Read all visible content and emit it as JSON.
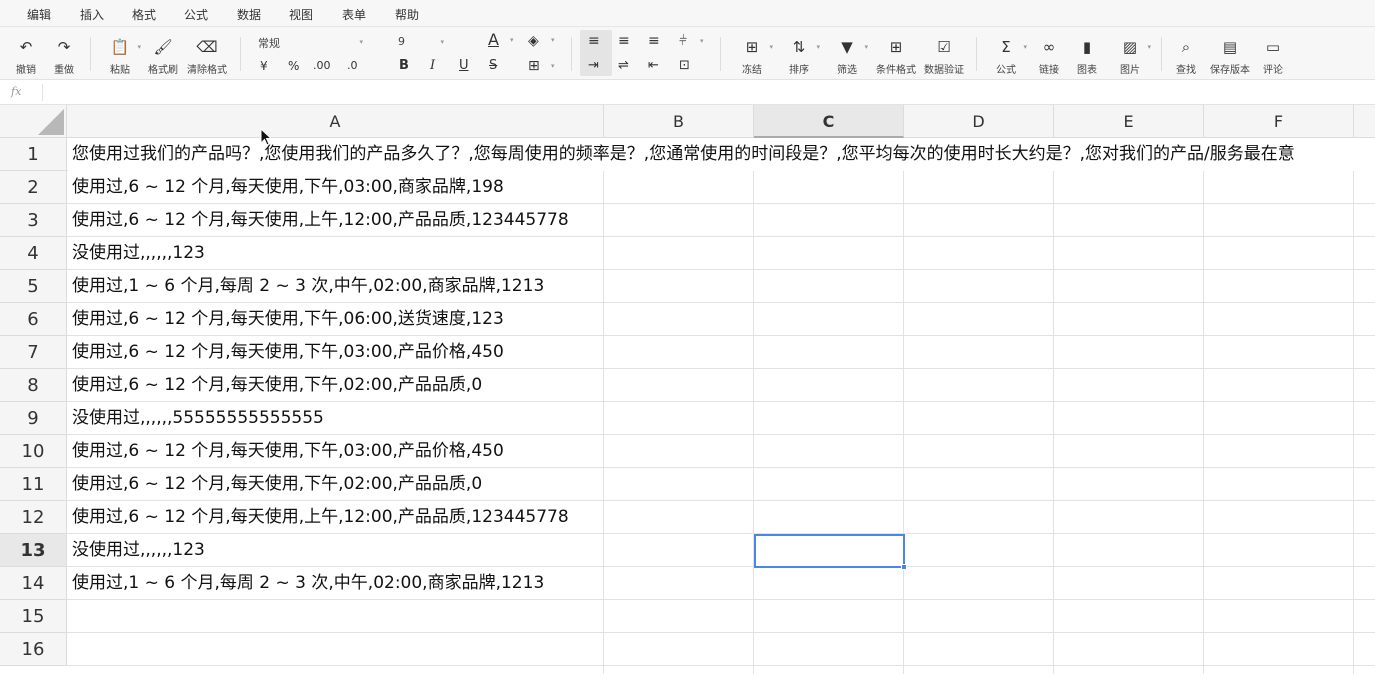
{
  "menu": [
    "编辑",
    "插入",
    "格式",
    "公式",
    "数据",
    "视图",
    "表单",
    "帮助"
  ],
  "toolbar": {
    "undo": "撤销",
    "redo": "重做",
    "paste": "粘贴",
    "format_painter": "格式刷",
    "clear_format": "清除格式",
    "number_format": "常规",
    "font_size": "9",
    "currency": "¥",
    "percent": "%",
    "dec_inc": ".00",
    "dec_dec": ".0",
    "bold": "B",
    "italic": "I",
    "underline": "U",
    "strike": "S",
    "font_color_glyph": "A",
    "freeze": "冻结",
    "sort": "排序",
    "filter": "筛选",
    "conditional_format": "条件格式",
    "data_validation": "数据验证",
    "formula": "公式",
    "link": "链接",
    "chart": "图表",
    "image": "图片",
    "find": "查找",
    "save_version": "保存版本",
    "comment": "评论"
  },
  "formula_bar": {
    "fx_label": "fx",
    "content": ""
  },
  "columns": [
    "A",
    "B",
    "C",
    "D",
    "E",
    "F"
  ],
  "active_column": "C",
  "active_row": 13,
  "rows": [
    {
      "num": "1",
      "a": "您使用过我们的产品吗？,您使用我们的产品多久了？,您每周使用的频率是？,您通常使用的时间段是？,您平均每次的使用时长大约是？,您对我们的产品/服务最在意"
    },
    {
      "num": "2",
      "a": "使用过,6 ~ 12 个月,每天使用,下午,03:00,商家品牌,198"
    },
    {
      "num": "3",
      "a": "使用过,6 ~ 12 个月,每天使用,上午,12:00,产品品质,123445778"
    },
    {
      "num": "4",
      "a": "没使用过,,,,,,123"
    },
    {
      "num": "5",
      "a": "使用过,1 ~ 6 个月,每周 2 ~ 3 次,中午,02:00,商家品牌,1213"
    },
    {
      "num": "6",
      "a": "使用过,6 ~ 12 个月,每天使用,下午,06:00,送货速度,123"
    },
    {
      "num": "7",
      "a": "使用过,6 ~ 12 个月,每天使用,下午,03:00,产品价格,450"
    },
    {
      "num": "8",
      "a": "使用过,6 ~ 12 个月,每天使用,下午,02:00,产品品质,0"
    },
    {
      "num": "9",
      "a": "没使用过,,,,,,55555555555555"
    },
    {
      "num": "10",
      "a": "使用过,6 ~ 12 个月,每天使用,下午,03:00,产品价格,450"
    },
    {
      "num": "11",
      "a": "使用过,6 ~ 12 个月,每天使用,下午,02:00,产品品质,0"
    },
    {
      "num": "12",
      "a": "使用过,6 ~ 12 个月,每天使用,上午,12:00,产品品质,123445778"
    },
    {
      "num": "13",
      "a": "没使用过,,,,,,123"
    },
    {
      "num": "14",
      "a": "使用过,1 ~ 6 个月,每周 2 ~ 3 次,中午,02:00,商家品牌,1213"
    },
    {
      "num": "15",
      "a": ""
    },
    {
      "num": "16",
      "a": ""
    }
  ],
  "colors": {
    "selection": "#4a86e8",
    "header_bg": "#f5f5f5",
    "grid": "#e2e2e2"
  }
}
